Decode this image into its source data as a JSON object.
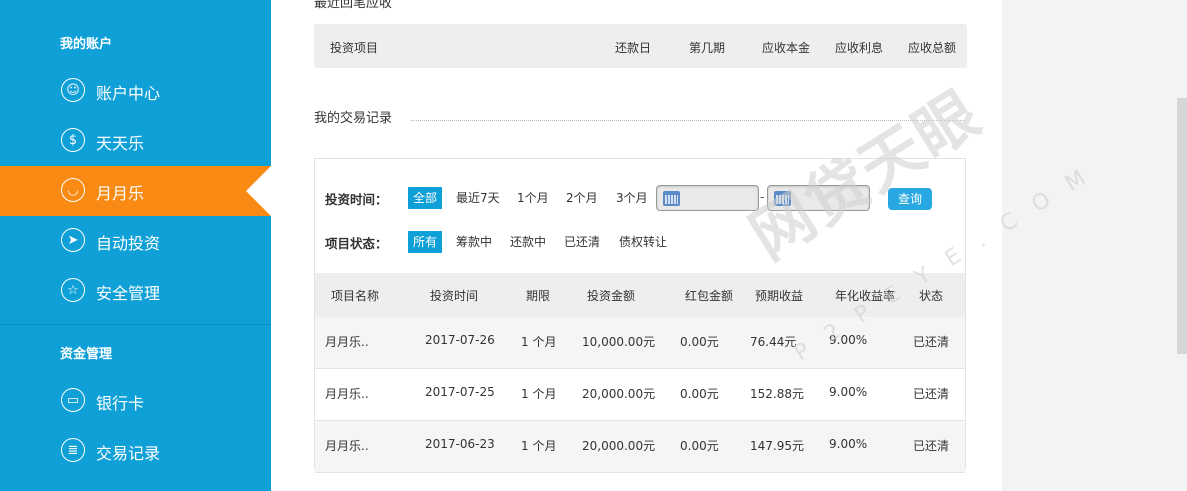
{
  "sidebar": {
    "section1": "我的账户",
    "section2": "资金管理",
    "items": [
      {
        "label": "账户中心",
        "icon": "user-icon",
        "glyph": "☺"
      },
      {
        "label": "天天乐",
        "icon": "money-bag-icon",
        "glyph": "$"
      },
      {
        "label": "月月乐",
        "icon": "piggy-bank-icon",
        "glyph": "◡"
      },
      {
        "label": "自动投资",
        "icon": "paper-plane-icon",
        "glyph": "➤"
      },
      {
        "label": "安全管理",
        "icon": "star-icon",
        "glyph": "☆"
      },
      {
        "label": "银行卡",
        "icon": "bank-card-icon",
        "glyph": "▭"
      },
      {
        "label": "交易记录",
        "icon": "transaction-record-icon",
        "glyph": "≣"
      }
    ],
    "active_index": 2,
    "colors": {
      "bg": "#0fa0d8",
      "active": "#f98a14"
    }
  },
  "receivables": {
    "title": "最近回笔应收",
    "columns": [
      "投资项目",
      "还款日",
      "第几期",
      "应收本金",
      "应收利息",
      "应收总额"
    ]
  },
  "records": {
    "title": "我的交易记录",
    "filters": {
      "time_label": "投资时间：",
      "time_options": [
        "全部",
        "最近7天",
        "1个月",
        "2个月",
        "3个月"
      ],
      "time_selected": 0,
      "date_separator": "-",
      "query_label": "查询",
      "status_label": "项目状态：",
      "status_options": [
        "所有",
        "筹款中",
        "还款中",
        "已还清",
        "债权转让"
      ],
      "status_selected": 0
    },
    "columns": [
      "项目名称",
      "投资时间",
      "期限",
      "投资金额",
      "红包金额",
      "预期收益",
      "年化收益率",
      "状态"
    ],
    "rows": [
      [
        "月月乐..",
        "2017-07-26",
        "1 个月",
        "10,000.00元",
        "0.00元",
        "76.44元",
        "9.00%",
        "已还清"
      ],
      [
        "月月乐..",
        "2017-07-25",
        "1 个月",
        "20,000.00元",
        "0.00元",
        "152.88元",
        "9.00%",
        "已还清"
      ],
      [
        "月月乐..",
        "2017-06-23",
        "1 个月",
        "20,000.00元",
        "0.00元",
        "147.95元",
        "9.00%",
        "已还清"
      ]
    ]
  },
  "watermark": {
    "text": "网贷天眼",
    "sub": "P2PEYE.COM"
  }
}
